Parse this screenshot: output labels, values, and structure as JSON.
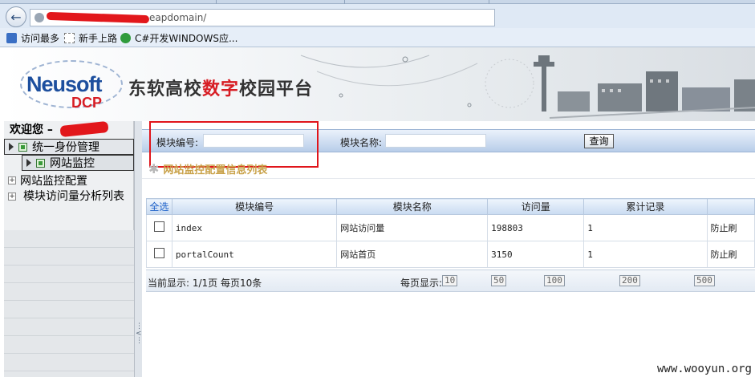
{
  "browser": {
    "url_tail": "eapdomain/",
    "bookmarks": [
      "访问最多",
      "新手上路",
      "C#开发WINDOWS应..."
    ]
  },
  "banner": {
    "logo_main": "Neusoft",
    "logo_sub": "DCP",
    "title_part1": "东软高校",
    "title_highlight": "数字",
    "title_part2": "校园平台"
  },
  "sidebar": {
    "welcome": "欢迎您 –",
    "items": [
      {
        "label": "统一身份管理"
      },
      {
        "label": "网站监控"
      },
      {
        "label": "网站监控配置"
      },
      {
        "label": "模块访问量分析列表"
      }
    ]
  },
  "search": {
    "code_label": "模块编号:",
    "code_value": "",
    "name_label": "模块名称:",
    "name_value": "",
    "query_button": "查询"
  },
  "section": {
    "title": "网站监控配置信息列表"
  },
  "table": {
    "select_all": "全选",
    "columns": [
      "模块编号",
      "模块名称",
      "访问量",
      "累计记录"
    ],
    "rows": [
      {
        "code": "index",
        "name": "网站访问量",
        "visits": "198803",
        "records": "1",
        "extra": "防止刷"
      },
      {
        "code": "portalCount",
        "name": "网站首页",
        "visits": "3150",
        "records": "1",
        "extra": "防止刷"
      }
    ]
  },
  "pager": {
    "current": "当前显示: 1/1页 每页10条",
    "page_size_label": "每页显示:",
    "page_sizes": [
      "10",
      "50",
      "100",
      "200",
      "500"
    ]
  },
  "watermark": "www.wooyun.org",
  "colors": {
    "accent_red": "#e0151b",
    "logo_blue": "#1d4f9e",
    "section_title": "#c9a24a",
    "header_blue": "#c9dbf1"
  }
}
